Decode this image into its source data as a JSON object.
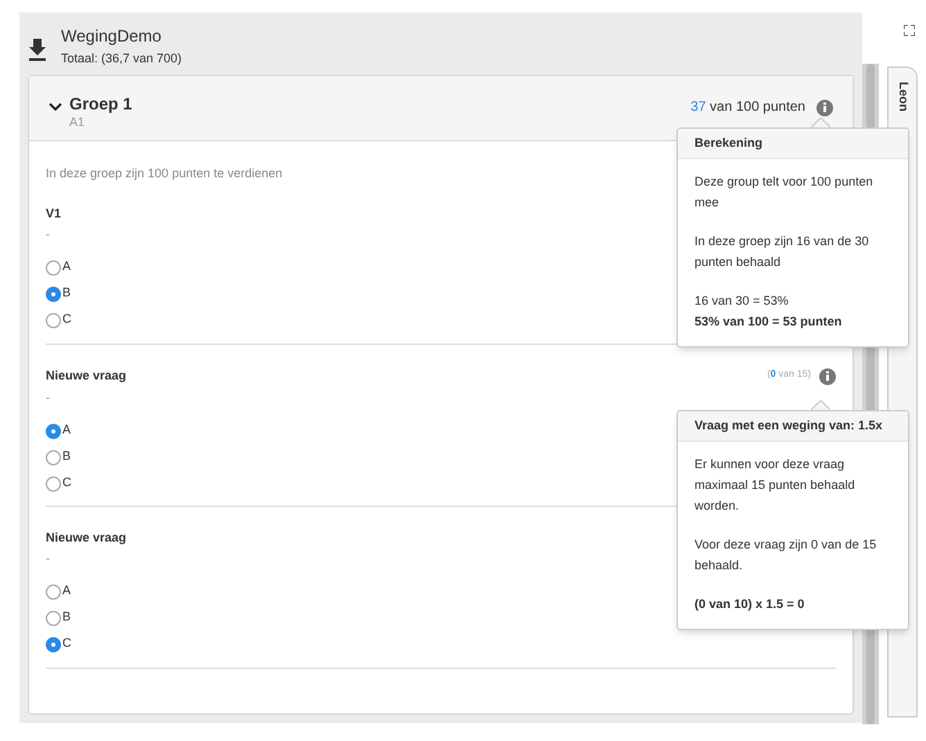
{
  "header": {
    "title": "WegingDemo",
    "subtitle": "Totaal: (36,7 van 700)"
  },
  "side_tab": {
    "label": "Leon"
  },
  "group": {
    "title": "Groep 1",
    "code": "A1",
    "expanded": true,
    "score": {
      "earned": "37",
      "rest": "van 100 punten"
    },
    "intro": "In deze groep zijn 100 punten te verdienen",
    "tooltip": {
      "title": "Berekening",
      "paragraphs": [
        [
          {
            "text": "Deze group telt voor 100 punten mee",
            "bold": false
          }
        ],
        [
          {
            "text": "In deze groep zijn 16 van de 30 punten behaald",
            "bold": false
          }
        ],
        [
          {
            "text": "16 van 30 = 53%",
            "bold": false
          },
          {
            "text": "53% van 100 = 53 punten",
            "bold": true
          }
        ]
      ]
    }
  },
  "questions": [
    {
      "title": "V1",
      "description": "-",
      "options": [
        {
          "label": "A",
          "selected": false
        },
        {
          "label": "B",
          "selected": true
        },
        {
          "label": "C",
          "selected": false
        }
      ]
    },
    {
      "title": "Nieuwe vraag",
      "description": "-",
      "score": {
        "open": "(",
        "earned": "0",
        "rest": "van 15)"
      },
      "tooltip": {
        "title": "Vraag met een weging van: 1.5x",
        "paragraphs": [
          [
            {
              "text": "Er kunnen voor deze vraag maximaal 15 punten behaald worden.",
              "bold": false
            }
          ],
          [
            {
              "text": "Voor deze vraag zijn 0 van de 15 behaald.",
              "bold": false
            }
          ],
          [
            {
              "text": "(0 van 10) x 1.5 = 0",
              "bold": true
            }
          ]
        ]
      },
      "options": [
        {
          "label": "A",
          "selected": true
        },
        {
          "label": "B",
          "selected": false
        },
        {
          "label": "C",
          "selected": false
        }
      ]
    },
    {
      "title": "Nieuwe vraag",
      "description": "-",
      "options": [
        {
          "label": "A",
          "selected": false
        },
        {
          "label": "B",
          "selected": false
        },
        {
          "label": "C",
          "selected": true
        }
      ]
    }
  ]
}
